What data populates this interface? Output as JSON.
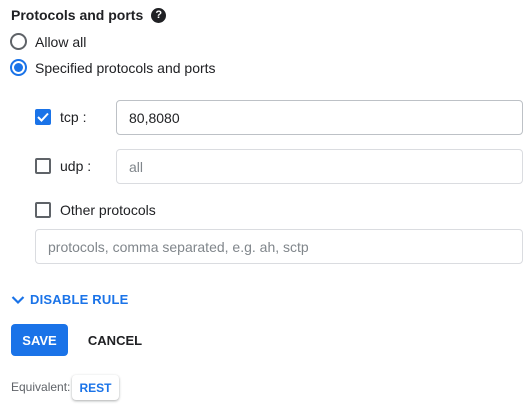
{
  "section": {
    "title": "Protocols and ports",
    "help_icon": "help-icon"
  },
  "mode_options": [
    {
      "label": "Allow all",
      "selected": false
    },
    {
      "label": "Specified protocols and ports",
      "selected": true
    }
  ],
  "protocols": {
    "tcp": {
      "label": "tcp :",
      "checked": true,
      "value": "80,8080",
      "placeholder": ""
    },
    "udp": {
      "label": "udp :",
      "checked": false,
      "value": "",
      "placeholder": "all"
    },
    "other": {
      "label": "Other protocols",
      "checked": false,
      "value": "",
      "placeholder": "protocols, comma separated, e.g. ah, sctp"
    }
  },
  "toggle_rule": {
    "label": "DISABLE RULE",
    "icon": "chevron-down-icon"
  },
  "actions": {
    "save_label": "SAVE",
    "cancel_label": "CANCEL"
  },
  "equivalent": {
    "label": "Equivalent:",
    "rest_label": "REST"
  },
  "colors": {
    "accent": "#1a73e8",
    "text": "#202124",
    "border": "#dadce0"
  }
}
